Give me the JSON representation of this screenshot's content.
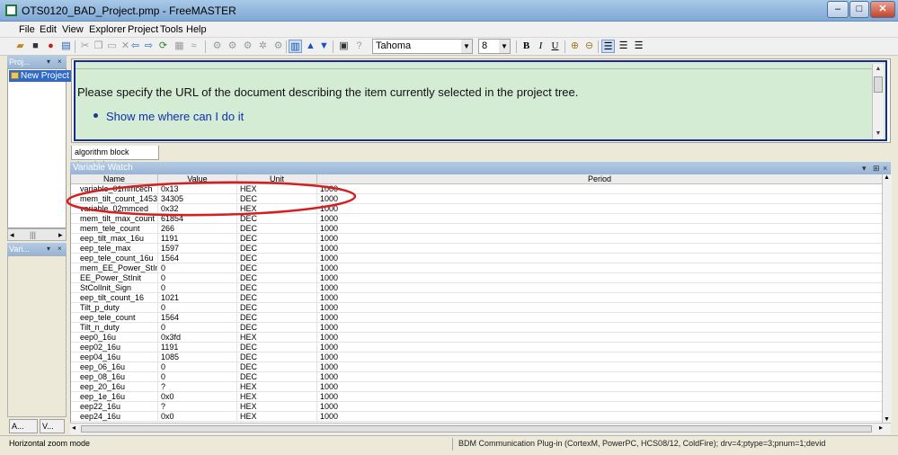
{
  "window": {
    "title": "OTS0120_BAD_Project.pmp - FreeMASTER",
    "minimize": "–",
    "maximize": "□",
    "close": "✕"
  },
  "menu": [
    "File",
    "Edit",
    "View",
    "Explorer",
    "Project",
    "Tools",
    "Help"
  ],
  "toolbar": {
    "font_name": "Tahoma",
    "font_size": "8",
    "bold": "B",
    "italic": "I",
    "underline": "U"
  },
  "project_panel": {
    "title": "Proj...",
    "tree_item": "New Project"
  },
  "variables_panel": {
    "title": "Vari..."
  },
  "left_tabs": [
    "A...",
    "V..."
  ],
  "description": {
    "message": "Please specify the URL of the document describing the item currently selected in the project tree.",
    "link": "Show me where can I do it",
    "tab": "algorithm block description"
  },
  "watch": {
    "title": "Variable Watch",
    "columns": [
      "Name",
      "Value",
      "Unit",
      "Period"
    ],
    "rows": [
      {
        "name": "variable_01mmcech",
        "value": "0x13",
        "unit": "HEX",
        "period": "1000"
      },
      {
        "name": "mem_tilt_count_1453",
        "value": "34305",
        "unit": "DEC",
        "period": "1000"
      },
      {
        "name": "variable_02mmced",
        "value": "0x32",
        "unit": "HEX",
        "period": "1000"
      },
      {
        "name": "mem_tilt_max_count",
        "value": "61854",
        "unit": "DEC",
        "period": "1000"
      },
      {
        "name": "mem_tele_count",
        "value": "266",
        "unit": "DEC",
        "period": "1000"
      },
      {
        "name": "eep_tilt_max_16u",
        "value": "1191",
        "unit": "DEC",
        "period": "1000"
      },
      {
        "name": "eep_tele_max",
        "value": "1597",
        "unit": "DEC",
        "period": "1000"
      },
      {
        "name": "eep_tele_count_16u",
        "value": "1564",
        "unit": "DEC",
        "period": "1000"
      },
      {
        "name": "mem_EE_Power_StInit",
        "value": "0",
        "unit": "DEC",
        "period": "1000"
      },
      {
        "name": "EE_Power_StInit",
        "value": "0",
        "unit": "DEC",
        "period": "1000"
      },
      {
        "name": "StColInit_Sign",
        "value": "0",
        "unit": "DEC",
        "period": "1000"
      },
      {
        "name": "eep_tilt_count_16",
        "value": "1021",
        "unit": "DEC",
        "period": "1000"
      },
      {
        "name": "Tilt_p_duty",
        "value": "0",
        "unit": "DEC",
        "period": "1000"
      },
      {
        "name": "eep_tele_count",
        "value": "1564",
        "unit": "DEC",
        "period": "1000"
      },
      {
        "name": "Tilt_n_duty",
        "value": "0",
        "unit": "DEC",
        "period": "1000"
      },
      {
        "name": "eep0_16u",
        "value": "0x3fd",
        "unit": "HEX",
        "period": "1000"
      },
      {
        "name": "eep02_16u",
        "value": "1191",
        "unit": "DEC",
        "period": "1000"
      },
      {
        "name": "eep04_16u",
        "value": "1085",
        "unit": "DEC",
        "period": "1000"
      },
      {
        "name": "eep_06_16u",
        "value": "0",
        "unit": "DEC",
        "period": "1000"
      },
      {
        "name": "eep_08_16u",
        "value": "0",
        "unit": "DEC",
        "period": "1000"
      },
      {
        "name": "eep_20_16u",
        "value": "?",
        "unit": "HEX",
        "period": "1000"
      },
      {
        "name": "eep_1e_16u",
        "value": "0x0",
        "unit": "HEX",
        "period": "1000"
      },
      {
        "name": "eep22_16u",
        "value": "?",
        "unit": "HEX",
        "period": "1000"
      },
      {
        "name": "eep24_16u",
        "value": "0x0",
        "unit": "HEX",
        "period": "1000"
      }
    ]
  },
  "status": {
    "left": "Horizontal zoom mode",
    "right": "BDM Communication Plug-in (CortexM, PowerPC, HCS08/12, ColdFire); drv=4;ptype=3;pnum=1;devid"
  },
  "colors": {
    "annotation": "#d42020",
    "selection": "#3169c6",
    "desc_background": "#d4ebd4",
    "desc_border": "#1a2a8a",
    "link": "#1030b0"
  }
}
